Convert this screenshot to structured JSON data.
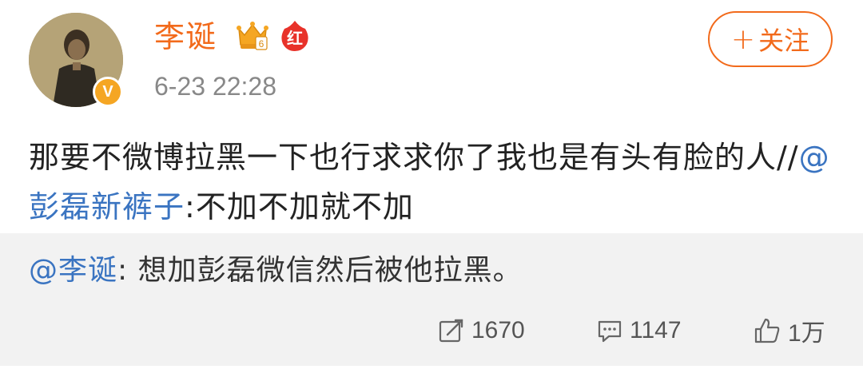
{
  "post": {
    "user_name": "李诞",
    "timestamp": "6-23 22:28",
    "follow_label": "关注",
    "follow_plus": "+",
    "body_text": "那要不微博拉黑一下也行求求你了我也是有头有脸的人//",
    "body_mention": "@彭磊新裤子",
    "body_quote": ":不加不加就不加",
    "badge_crown_level": "6",
    "badge_hong": "红",
    "verified_mark": "V"
  },
  "repost": {
    "mention": "@李诞",
    "text": ": 想加彭磊微信然后被他拉黑。"
  },
  "actions": {
    "repost_count": "1670",
    "comment_count": "1147",
    "like_count": "1万"
  },
  "colors": {
    "accent_orange": "#f26a1b",
    "mention_blue": "#3a74c1",
    "repost_bg": "#f2f2f2",
    "verified_gold": "#f5a623"
  }
}
